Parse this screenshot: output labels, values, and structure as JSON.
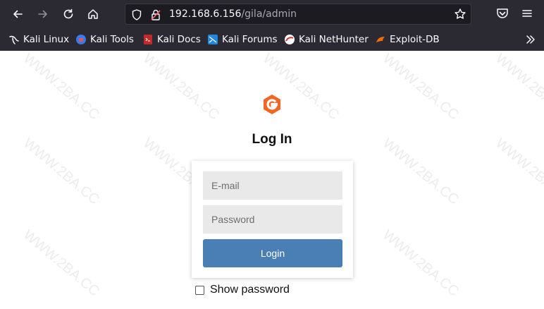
{
  "browser": {
    "url_host": "192.168.6.156",
    "url_path": "/gila/admin",
    "bookmarks": [
      {
        "label": "Kali Linux",
        "icon": "kali-dragon-icon"
      },
      {
        "label": "Kali Tools",
        "icon": "kali-tools-icon"
      },
      {
        "label": "Kali Docs",
        "icon": "kali-docs-icon"
      },
      {
        "label": "Kali Forums",
        "icon": "kali-forums-icon"
      },
      {
        "label": "Kali NetHunter",
        "icon": "nethunter-icon"
      },
      {
        "label": "Exploit-DB",
        "icon": "exploit-db-icon"
      }
    ]
  },
  "page": {
    "title": "Log In",
    "email_placeholder": "E-mail",
    "password_placeholder": "Password",
    "login_label": "Login",
    "show_password_label": "Show password"
  },
  "watermark": "WWW.2BA.CC",
  "colors": {
    "chrome_bg": "#2b2a33",
    "urlbar_bg": "#1c1b22",
    "logo_orange": "#f26522",
    "login_button": "#4a7fb5",
    "field_bg": "#e9e9e9"
  }
}
